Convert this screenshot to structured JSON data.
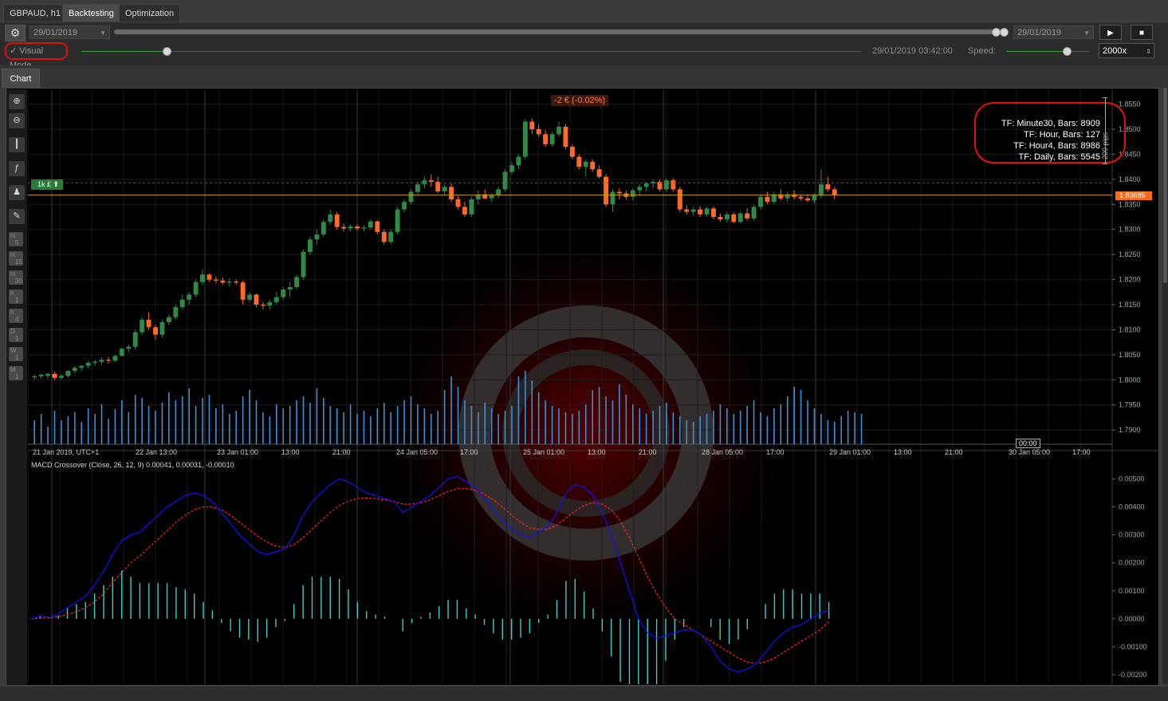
{
  "tabs": [
    {
      "label": "GBPAUD, h1"
    },
    {
      "label": "Backtesting"
    },
    {
      "label": "Optimization"
    }
  ],
  "toolbar": {
    "start_date": "29/01/2019",
    "end_date": "29/01/2019",
    "visual_mode_label": "Visual Mode",
    "visual_mode_checked": true,
    "current_time": "29/01/2019 03:42:00",
    "speed_label": "Speed:",
    "speed_value": "2000x",
    "play_icon": "play-icon",
    "stop_icon": "stop-icon"
  },
  "chart_tab": {
    "label": "Chart"
  },
  "chart": {
    "pnl_badge": "-2 € (-0.02%)",
    "position_badge": "1k £",
    "current_price_label": "1.83685",
    "pips_label": "200 pips",
    "tf_info": [
      "TF: Minute30, Bars: 8909",
      "TF: Hour, Bars: 127",
      "TF: Hour4, Bars: 8986",
      "TF: Daily, Bars: 5545"
    ],
    "timezone_label": "21 Jan 2019, UTC+1",
    "hover_time": "00:00",
    "x_labels": [
      "22 Jan 13:00",
      "23 Jan 01:00",
      "13:00",
      "21:00",
      "24 Jan 05:00",
      "17:00",
      "25 Jan 01:00",
      "13:00",
      "21:00",
      "28 Jan 05:00",
      "17:00",
      "29 Jan 01:00",
      "13:00",
      "21:00",
      "30 Jan 05:00",
      "17:00"
    ],
    "price_ticks": [
      "1.8550",
      "1.8500",
      "1.8450",
      "1.8400",
      "1.8350",
      "1.8300",
      "1.8250",
      "1.8200",
      "1.8150",
      "1.8100",
      "1.8050",
      "1.8000",
      "1.7950",
      "1.7900"
    ],
    "indicator_label": "MACD Crossover (Close, 26, 12, 9) 0.00041, 0.00031, -0.00010",
    "macd_ticks": [
      "0.00500",
      "0.00400",
      "0.00300",
      "0.00200",
      "0.00100",
      "0.00000",
      "-0.00100",
      "-0.00200"
    ],
    "timeframe_buttons": [
      {
        "top": "m",
        "bottom": "5"
      },
      {
        "top": "m",
        "bottom": "15"
      },
      {
        "top": "m",
        "bottom": "30"
      },
      {
        "top": "h",
        "bottom": "1"
      },
      {
        "top": "h",
        "bottom": "4"
      },
      {
        "top": "D",
        "bottom": "1"
      },
      {
        "top": "W",
        "bottom": "1"
      },
      {
        "top": "M",
        "bottom": "1"
      }
    ],
    "colors": {
      "bull": "#2e8b45",
      "bear": "#ff6a2a",
      "volume": "#3b8fd6",
      "macd_line": "#1010ff",
      "signal_line": "#ff2020",
      "histogram": "#38d0cc",
      "price_line": "#c8a000"
    }
  },
  "chart_data": {
    "type": "candlestick",
    "price_range": [
      1.787,
      1.857
    ],
    "candles": [
      [
        1.8005,
        1.801,
        1.8001,
        1.8007
      ],
      [
        1.8007,
        1.8013,
        1.8003,
        1.801
      ],
      [
        1.8008,
        1.8014,
        1.8002,
        1.8012
      ],
      [
        1.8012,
        1.8016,
        1.8,
        1.8004
      ],
      [
        1.8004,
        1.8012,
        1.8,
        1.8008
      ],
      [
        1.8008,
        1.802,
        1.8005,
        1.8018
      ],
      [
        1.8018,
        1.8028,
        1.8013,
        1.8024
      ],
      [
        1.8024,
        1.803,
        1.8018,
        1.8028
      ],
      [
        1.8028,
        1.8038,
        1.8022,
        1.8034
      ],
      [
        1.8034,
        1.804,
        1.8028,
        1.8036
      ],
      [
        1.8036,
        1.8045,
        1.803,
        1.804
      ],
      [
        1.804,
        1.8046,
        1.8032,
        1.8038
      ],
      [
        1.8038,
        1.805,
        1.8036,
        1.8048
      ],
      [
        1.8048,
        1.8065,
        1.8046,
        1.8062
      ],
      [
        1.8062,
        1.807,
        1.8055,
        1.8066
      ],
      [
        1.8066,
        1.81,
        1.806,
        1.8095
      ],
      [
        1.8095,
        1.8125,
        1.809,
        1.812
      ],
      [
        1.812,
        1.8135,
        1.81,
        1.8105
      ],
      [
        1.8105,
        1.811,
        1.808,
        1.809
      ],
      [
        1.809,
        1.812,
        1.8085,
        1.8115
      ],
      [
        1.8115,
        1.813,
        1.811,
        1.8125
      ],
      [
        1.8125,
        1.815,
        1.812,
        1.8145
      ],
      [
        1.8145,
        1.817,
        1.814,
        1.816
      ],
      [
        1.816,
        1.8175,
        1.815,
        1.817
      ],
      [
        1.817,
        1.82,
        1.8165,
        1.8195
      ],
      [
        1.8195,
        1.822,
        1.819,
        1.821
      ],
      [
        1.821,
        1.8212,
        1.8196,
        1.82
      ],
      [
        1.82,
        1.8206,
        1.8192,
        1.8198
      ],
      [
        1.8198,
        1.8204,
        1.819,
        1.8194
      ],
      [
        1.8194,
        1.8202,
        1.8186,
        1.8196
      ],
      [
        1.8196,
        1.82,
        1.819,
        1.8194
      ],
      [
        1.8194,
        1.8198,
        1.815,
        1.816
      ],
      [
        1.816,
        1.8175,
        1.8155,
        1.817
      ],
      [
        1.817,
        1.8172,
        1.8145,
        1.815
      ],
      [
        1.815,
        1.8155,
        1.814,
        1.8148
      ],
      [
        1.8148,
        1.816,
        1.814,
        1.8155
      ],
      [
        1.8155,
        1.8175,
        1.815,
        1.8165
      ],
      [
        1.8165,
        1.8185,
        1.816,
        1.818
      ],
      [
        1.818,
        1.8195,
        1.8165,
        1.8185
      ],
      [
        1.8185,
        1.821,
        1.818,
        1.8205
      ],
      [
        1.8205,
        1.826,
        1.82,
        1.8255
      ],
      [
        1.8255,
        1.8285,
        1.825,
        1.828
      ],
      [
        1.828,
        1.83,
        1.827,
        1.829
      ],
      [
        1.829,
        1.832,
        1.8285,
        1.8315
      ],
      [
        1.8315,
        1.834,
        1.831,
        1.833
      ],
      [
        1.833,
        1.8335,
        1.83,
        1.8305
      ],
      [
        1.8305,
        1.8312,
        1.8296,
        1.8302
      ],
      [
        1.8302,
        1.831,
        1.8296,
        1.8306
      ],
      [
        1.8306,
        1.831,
        1.8298,
        1.8302
      ],
      [
        1.8302,
        1.8308,
        1.8296,
        1.8304
      ],
      [
        1.8304,
        1.832,
        1.83,
        1.8316
      ],
      [
        1.8316,
        1.8318,
        1.829,
        1.8295
      ],
      [
        1.8295,
        1.83,
        1.827,
        1.8275
      ],
      [
        1.8275,
        1.83,
        1.827,
        1.8295
      ],
      [
        1.8295,
        1.8345,
        1.829,
        1.834
      ],
      [
        1.834,
        1.836,
        1.8335,
        1.8355
      ],
      [
        1.8355,
        1.838,
        1.835,
        1.8375
      ],
      [
        1.8375,
        1.8395,
        1.837,
        1.839
      ],
      [
        1.839,
        1.8405,
        1.8382,
        1.8398
      ],
      [
        1.8398,
        1.841,
        1.8385,
        1.8395
      ],
      [
        1.8395,
        1.8405,
        1.8372,
        1.8376
      ],
      [
        1.8376,
        1.839,
        1.837,
        1.8385
      ],
      [
        1.8385,
        1.8392,
        1.8355,
        1.836
      ],
      [
        1.836,
        1.8366,
        1.834,
        1.8345
      ],
      [
        1.8345,
        1.8355,
        1.8325,
        1.833
      ],
      [
        1.833,
        1.8365,
        1.8325,
        1.836
      ],
      [
        1.836,
        1.8378,
        1.835,
        1.837
      ],
      [
        1.837,
        1.838,
        1.836,
        1.8362
      ],
      [
        1.8362,
        1.8372,
        1.8355,
        1.8368
      ],
      [
        1.8368,
        1.8385,
        1.8362,
        1.838
      ],
      [
        1.838,
        1.842,
        1.8375,
        1.8415
      ],
      [
        1.8415,
        1.8435,
        1.841,
        1.8428
      ],
      [
        1.8428,
        1.845,
        1.842,
        1.8445
      ],
      [
        1.8445,
        1.852,
        1.844,
        1.8515
      ],
      [
        1.8515,
        1.8522,
        1.849,
        1.85
      ],
      [
        1.85,
        1.851,
        1.8485,
        1.849
      ],
      [
        1.849,
        1.8498,
        1.8465,
        1.847
      ],
      [
        1.847,
        1.8495,
        1.8465,
        1.849
      ],
      [
        1.849,
        1.8515,
        1.8485,
        1.8505
      ],
      [
        1.8505,
        1.851,
        1.846,
        1.8465
      ],
      [
        1.8465,
        1.847,
        1.844,
        1.8445
      ],
      [
        1.8445,
        1.845,
        1.842,
        1.8425
      ],
      [
        1.8425,
        1.844,
        1.8405,
        1.8435
      ],
      [
        1.8435,
        1.844,
        1.8415,
        1.842
      ],
      [
        1.842,
        1.8428,
        1.8402,
        1.8405
      ],
      [
        1.8405,
        1.841,
        1.8345,
        1.835
      ],
      [
        1.835,
        1.838,
        1.8335,
        1.8375
      ],
      [
        1.8375,
        1.8382,
        1.836,
        1.8372
      ],
      [
        1.8372,
        1.8378,
        1.836,
        1.8365
      ],
      [
        1.8365,
        1.8382,
        1.8358,
        1.8378
      ],
      [
        1.8378,
        1.839,
        1.837,
        1.8385
      ],
      [
        1.8385,
        1.8395,
        1.8375,
        1.8392
      ],
      [
        1.8392,
        1.84,
        1.8382,
        1.8395
      ],
      [
        1.8395,
        1.84,
        1.8376,
        1.838
      ],
      [
        1.838,
        1.8402,
        1.8375,
        1.8398
      ],
      [
        1.8398,
        1.8402,
        1.8375,
        1.838
      ],
      [
        1.838,
        1.8385,
        1.8335,
        1.834
      ],
      [
        1.834,
        1.8348,
        1.833,
        1.8335
      ],
      [
        1.8335,
        1.8345,
        1.8328,
        1.834
      ],
      [
        1.834,
        1.8346,
        1.8325,
        1.833
      ],
      [
        1.833,
        1.8345,
        1.8326,
        1.8342
      ],
      [
        1.8342,
        1.8346,
        1.832,
        1.8325
      ],
      [
        1.8325,
        1.8332,
        1.8315,
        1.832
      ],
      [
        1.832,
        1.8335,
        1.8314,
        1.833
      ],
      [
        1.833,
        1.8334,
        1.8312,
        1.8315
      ],
      [
        1.8315,
        1.8335,
        1.8312,
        1.8332
      ],
      [
        1.8332,
        1.8342,
        1.8318,
        1.8322
      ],
      [
        1.8322,
        1.835,
        1.8318,
        1.8345
      ],
      [
        1.8345,
        1.837,
        1.834,
        1.8365
      ],
      [
        1.8365,
        1.8375,
        1.835,
        1.8355
      ],
      [
        1.8355,
        1.8375,
        1.835,
        1.837
      ],
      [
        1.837,
        1.838,
        1.8358,
        1.8362
      ],
      [
        1.8362,
        1.8375,
        1.8355,
        1.837
      ],
      [
        1.837,
        1.8378,
        1.836,
        1.8365
      ],
      [
        1.8365,
        1.837,
        1.8358,
        1.8362
      ],
      [
        1.8362,
        1.837,
        1.8355,
        1.8358
      ],
      [
        1.8358,
        1.8372,
        1.8352,
        1.8368
      ],
      [
        1.8368,
        1.842,
        1.8362,
        1.839
      ],
      [
        1.839,
        1.8405,
        1.8375,
        1.838
      ],
      [
        1.838,
        1.8385,
        1.836,
        1.8368
      ]
    ],
    "volume": [
      30,
      38,
      22,
      42,
      30,
      35,
      40,
      28,
      45,
      38,
      50,
      32,
      44,
      55,
      40,
      62,
      58,
      48,
      42,
      52,
      65,
      55,
      60,
      70,
      48,
      58,
      62,
      45,
      50,
      38,
      42,
      60,
      68,
      55,
      40,
      35,
      50,
      45,
      48,
      55,
      60,
      52,
      70,
      58,
      48,
      45,
      40,
      50,
      38,
      42,
      35,
      45,
      52,
      40,
      48,
      55,
      60,
      50,
      45,
      38,
      42,
      68,
      85,
      72,
      55,
      48,
      40,
      52,
      45,
      38,
      42,
      48,
      85,
      92,
      80,
      65,
      55,
      48,
      45,
      40,
      38,
      42,
      50,
      68,
      72,
      60,
      55,
      75,
      62,
      50,
      45,
      38,
      42,
      48,
      52,
      40,
      35,
      30,
      28,
      35,
      38,
      42,
      50,
      45,
      38,
      42,
      48,
      55,
      40,
      35,
      45,
      50,
      60,
      72,
      68,
      55,
      45,
      38,
      30,
      28,
      35,
      42,
      40,
      38
    ],
    "macd": [
      0.0,
      0.0001,
      5e-05,
      0.00015,
      0.0004,
      0.0006,
      0.0008,
      0.0012,
      0.0017,
      0.0023,
      0.0028,
      0.003,
      0.0031,
      0.0034,
      0.0037,
      0.004,
      0.0042,
      0.0044,
      0.0045,
      0.0044,
      0.0042,
      0.0038,
      0.0034,
      0.003,
      0.0027,
      0.0024,
      0.0023,
      0.0024,
      0.0025,
      0.003,
      0.0037,
      0.0042,
      0.0045,
      0.0048,
      0.005,
      0.0049,
      0.0047,
      0.0045,
      0.0044,
      0.0043,
      0.0042,
      0.0038,
      0.004,
      0.0042,
      0.0044,
      0.0047,
      0.005,
      0.0051,
      0.0049,
      0.0047,
      0.0043,
      0.0039,
      0.0035,
      0.0032,
      0.003,
      0.0029,
      0.0031,
      0.0033,
      0.0038,
      0.0045,
      0.0048,
      0.0047,
      0.0044,
      0.0038,
      0.003,
      0.002,
      0.001,
      0.0,
      -0.0005,
      -0.0007,
      -0.0006,
      -0.0005,
      -0.0004,
      -0.0004,
      -0.0006,
      -0.001,
      -0.0015,
      -0.0018,
      -0.0019,
      -0.0018,
      -0.0016,
      -0.0012,
      -0.0008,
      -0.0005,
      -0.0003,
      -0.0002,
      0.0,
      0.0002,
      0.0003
    ],
    "signal": [
      0.0,
      2e-05,
      4e-05,
      8e-05,
      0.00015,
      0.00025,
      0.0004,
      0.0006,
      0.0009,
      0.0013,
      0.00165,
      0.002,
      0.00225,
      0.00255,
      0.00285,
      0.00315,
      0.00345,
      0.0037,
      0.0039,
      0.004,
      0.004,
      0.0039,
      0.0037,
      0.00345,
      0.0032,
      0.00295,
      0.00275,
      0.0026,
      0.00255,
      0.00265,
      0.0029,
      0.0032,
      0.0035,
      0.0038,
      0.00405,
      0.0042,
      0.0043,
      0.00432,
      0.0043,
      0.00425,
      0.0042,
      0.0041,
      0.0041,
      0.00415,
      0.00425,
      0.0044,
      0.00455,
      0.00465,
      0.00465,
      0.0046,
      0.00445,
      0.00425,
      0.004,
      0.0037,
      0.00345,
      0.00325,
      0.0032,
      0.0032,
      0.00335,
      0.0036,
      0.00385,
      0.00405,
      0.00415,
      0.0041,
      0.0039,
      0.0035,
      0.0029,
      0.0022,
      0.0015,
      0.0009,
      0.0004,
      0.0,
      -0.0002,
      -0.0004,
      -0.0006,
      -0.0008,
      -0.001,
      -0.0012,
      -0.0014,
      -0.00155,
      -0.0016,
      -0.00155,
      -0.0014,
      -0.0012,
      -0.001,
      -0.0008,
      -0.0006,
      -0.0004,
      -0.0001
    ],
    "macd_range": [
      -0.0022,
      0.0055
    ]
  }
}
